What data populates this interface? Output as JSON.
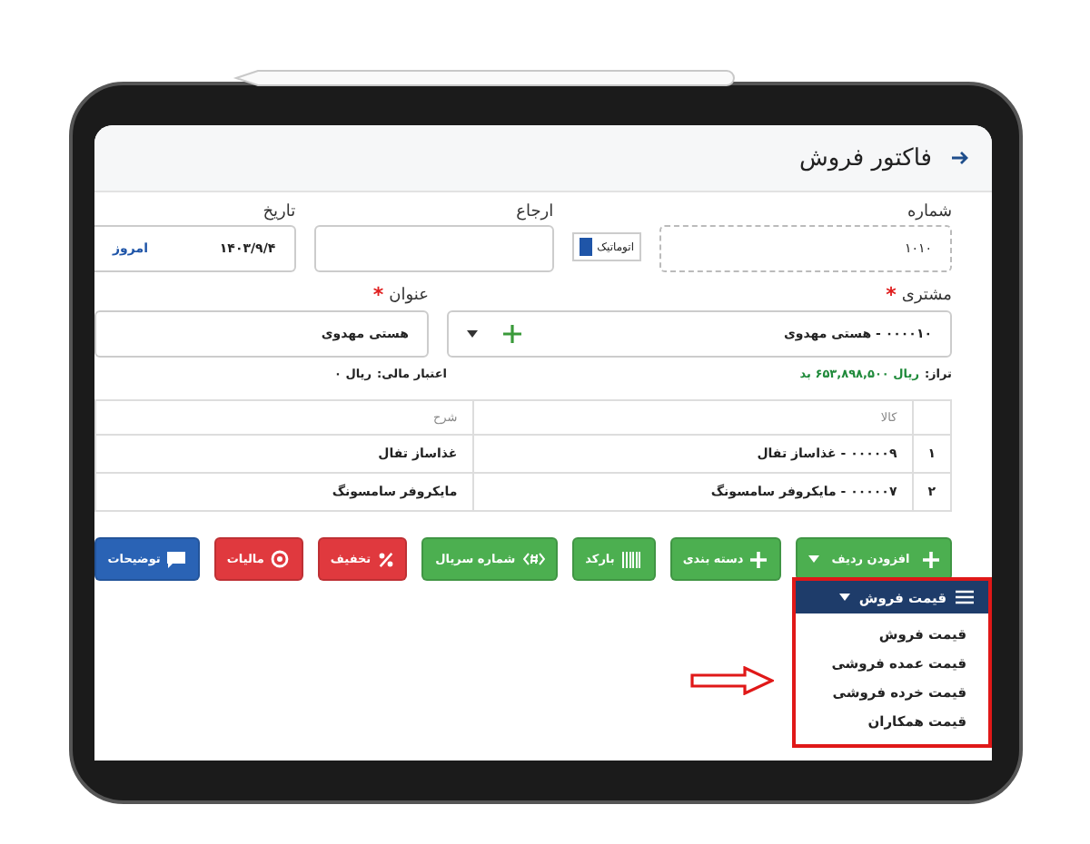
{
  "page": {
    "title": "فاکتور فروش"
  },
  "form": {
    "number": {
      "label": "شماره",
      "value": "۱۰۱۰"
    },
    "auto_toggle": {
      "label": "اتوماتیک",
      "checked": true
    },
    "reference": {
      "label": "ارجاع"
    },
    "date": {
      "label": "تاریخ",
      "value": "۱۴۰۳/۹/۴",
      "today_link": "امروز"
    },
    "customer": {
      "label": "مشتری",
      "required_mark": "*",
      "value": "۰۰۰۰۱۰ - هستی مهدوی"
    },
    "heading": {
      "label": "عنوان",
      "required_mark": "*",
      "value": "هستی مهدوی"
    },
    "balance": {
      "label": "تراز:",
      "value": "ریال ۶۵۳,۸۹۸,۵۰۰ بد"
    },
    "credit": {
      "label": "اعتبار مالی:",
      "value": "ریال ۰"
    }
  },
  "table": {
    "columns": [
      "کالا",
      "شرح"
    ],
    "rows": [
      {
        "index": "۱",
        "item": "۰۰۰۰۰۹ - غذاساز تفال",
        "description": "غذاساز تفال"
      },
      {
        "index": "۲",
        "item": "۰۰۰۰۰۷ - مایکروفر سامسونگ",
        "description": "مایکروفر سامسونگ"
      }
    ]
  },
  "buttons": [
    {
      "label": "افزودن ردیف",
      "kind": "add-row",
      "color": "#4caf50"
    },
    {
      "label": "دسته بندی",
      "kind": "plus",
      "color": "#4caf50"
    },
    {
      "label": "بارکد",
      "kind": "barcode",
      "color": "#4caf50"
    },
    {
      "label": "شماره سریال",
      "kind": "serial",
      "color": "#4caf50"
    },
    {
      "label": "تخفیف",
      "kind": "percent",
      "color": "#e0393e"
    },
    {
      "label": "مالیات",
      "kind": "coin",
      "color": "#e0393e"
    },
    {
      "label": "توضیحات",
      "kind": "comment",
      "color": "#2a63b5"
    }
  ],
  "price_menu": {
    "label": "قیمت فروش",
    "expanded": true,
    "items": [
      "قیمت فروش",
      "قیمت عمده فروشی",
      "قیمت خرده فروشی",
      "قیمت همکاران"
    ]
  }
}
